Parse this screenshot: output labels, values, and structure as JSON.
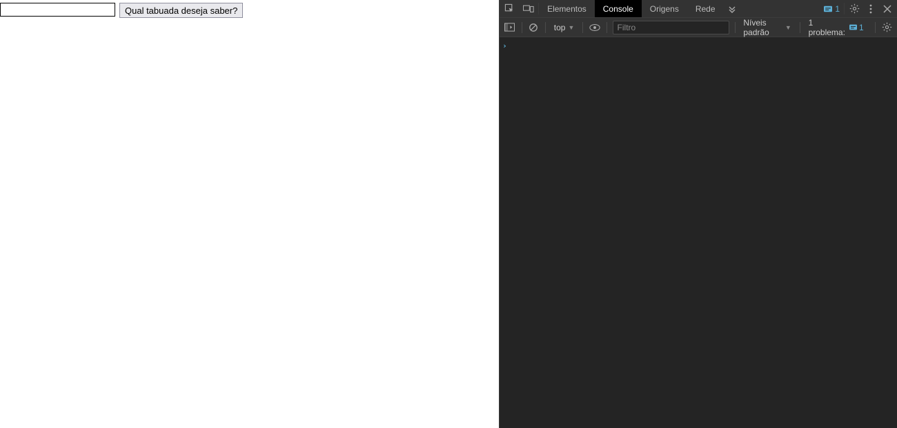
{
  "page": {
    "input_value": "",
    "button_label": "Qual tabuada deseja saber?"
  },
  "devtools": {
    "tabs": {
      "elements": "Elementos",
      "console": "Console",
      "sources": "Origens",
      "network": "Rede"
    },
    "issues_count": "1",
    "toolbar": {
      "context": "top",
      "filter_placeholder": "Filtro",
      "levels_label": "Níveis padrão",
      "problems_label": "1 problema:",
      "problems_count": "1"
    }
  }
}
